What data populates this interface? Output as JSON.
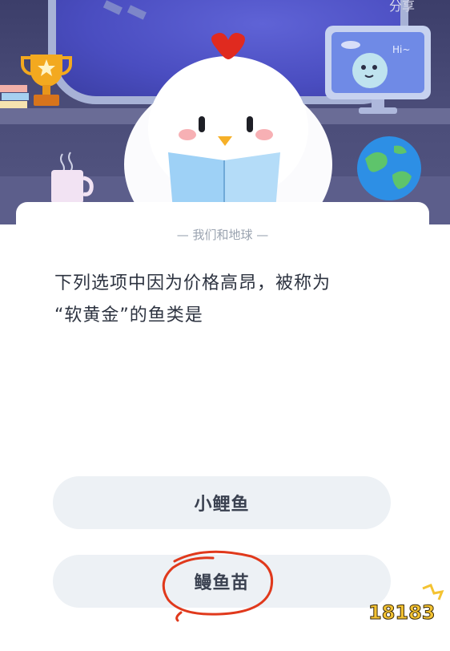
{
  "header_right": "分享",
  "card": {
    "category": "— 我们和地球 —",
    "question_line1": "下列选项中因为价格高昂，被称为",
    "question_line2": "“软黄金”的鱼类是"
  },
  "options": [
    {
      "label": "小鲤鱼"
    },
    {
      "label": "鳗鱼苗"
    }
  ],
  "monitor_text": "Hi~",
  "watermark_text": "18183",
  "colors": {
    "hero_bg": "#4a4c78",
    "option_bg": "#edf1f5",
    "annotation": "#e0391c",
    "chick_comb": "#e02a1f"
  }
}
